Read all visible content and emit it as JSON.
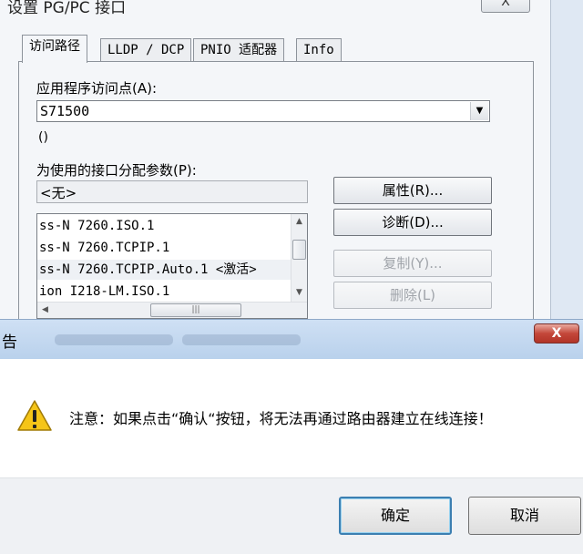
{
  "pgpc_window": {
    "title": "设置 PG/PC 接口",
    "close_label": "X",
    "tabs": [
      "访问路径",
      "LLDP / DCP",
      "PNIO 适配器",
      "Info"
    ],
    "access_point_label": "应用程序访问点(A):",
    "access_point_value": "S71500",
    "access_point_desc": "()",
    "interface_params_label": "为使用的接口分配参数(P):",
    "interface_params_value": "<无>",
    "interface_list": [
      "ss-N 7260.ISO.1",
      "ss-N 7260.TCPIP.1",
      "ss-N 7260.TCPIP.Auto.1  <激活>",
      "ion I218-LM.ISO.1"
    ],
    "selected_index": 2,
    "buttons": {
      "properties": "属性(R)...",
      "diagnose": "诊断(D)...",
      "copy": "复制(Y)...",
      "delete": "删除(L)"
    }
  },
  "warning_dialog": {
    "title": "告",
    "close_label": "X",
    "message": "注意：如果点击“确认“按钮，将无法再通过路由器建立在线连接！",
    "ok_label": "确定",
    "cancel_label": "取消"
  },
  "colors": {
    "dialog_title_bg": "#c4d8ef",
    "close_red": "#c4473a",
    "warning_yellow": "#f5c518"
  },
  "icons": {
    "warning": "warning-triangle-icon",
    "combo_arrow": "chevron-down-icon"
  }
}
